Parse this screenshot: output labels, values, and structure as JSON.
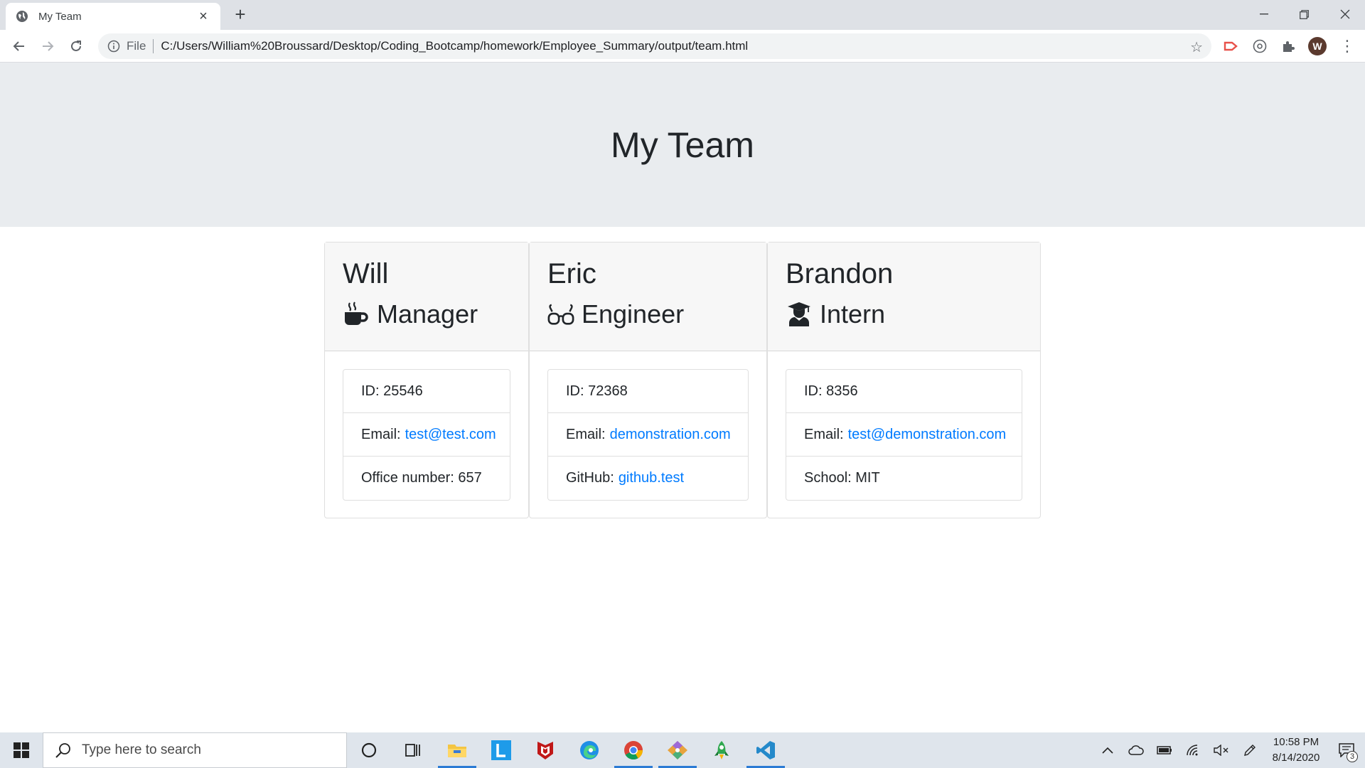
{
  "browser": {
    "tab_title": "My Team",
    "address_scheme": "File",
    "address_url": "C:/Users/William%20Broussard/Desktop/Coding_Bootcamp/homework/Employee_Summary/output/team.html",
    "profile_initial": "W"
  },
  "page": {
    "title": "My Team"
  },
  "cards": [
    {
      "name": "Will",
      "role": "Manager",
      "role_icon": "mug-hot-icon",
      "id_text": "ID: 25546",
      "email_label": "Email:",
      "email_value": "test@test.com",
      "extra_label": "Office number: 657",
      "extra_link": ""
    },
    {
      "name": "Eric",
      "role": "Engineer",
      "role_icon": "glasses-icon",
      "id_text": "ID: 72368",
      "email_label": "Email:",
      "email_value": "demonstration.com",
      "extra_label": "GitHub:",
      "extra_link": "github.test"
    },
    {
      "name": "Brandon",
      "role": "Intern",
      "role_icon": "user-graduate-icon",
      "id_text": "ID: 8356",
      "email_label": "Email:",
      "email_value": "test@demonstration.com",
      "extra_label": "School: MIT",
      "extra_link": ""
    }
  ],
  "taskbar": {
    "search_placeholder": "Type here to search",
    "time": "10:58 PM",
    "date": "8/14/2020",
    "notification_count": "3"
  },
  "colors": {
    "link": "#007bff",
    "jumbotron_bg": "#e9ecef",
    "card_header_bg": "#f7f7f7"
  }
}
